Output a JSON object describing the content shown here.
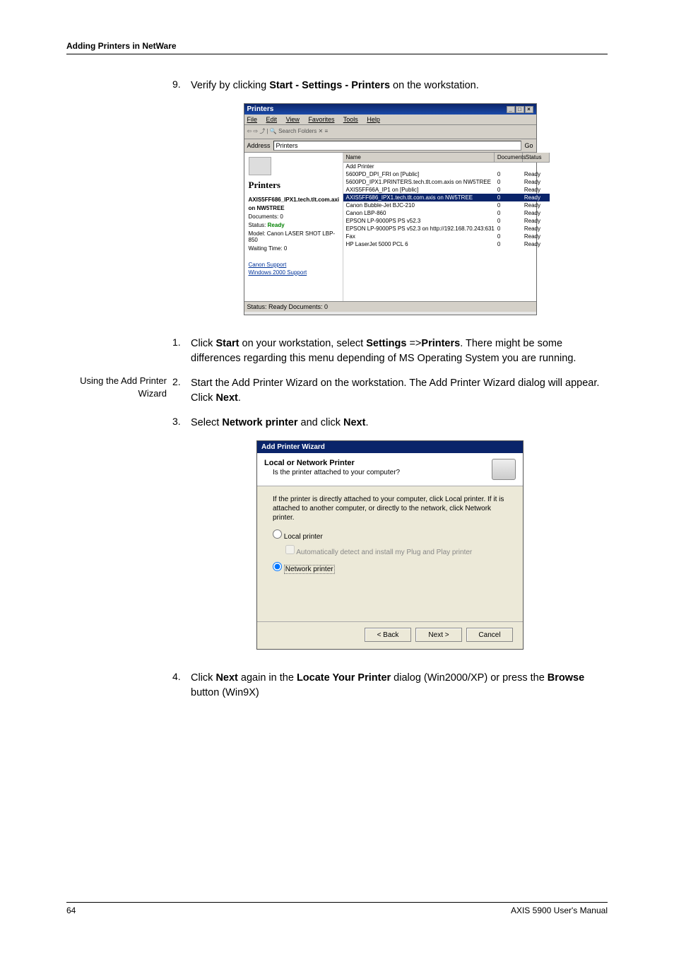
{
  "header": {
    "section_title": "Adding Printers in NetWare"
  },
  "step9": {
    "num": "9.",
    "text_before": "Verify by clicking ",
    "bold": "Start - Settings - Printers",
    "text_after": " on the workstation."
  },
  "printers_window": {
    "title": "Printers",
    "menu": {
      "file": "File",
      "edit": "Edit",
      "view": "View",
      "favorites": "Favorites",
      "tools": "Tools",
      "help": "Help"
    },
    "toolbar_hint": "Search    Folders",
    "address_label": "Address",
    "address_value": "Printers",
    "go_label": "Go",
    "left": {
      "title": "Printers",
      "selected_name_1": "AXIS5FF686_IPX1.tech.tlt.com.axi",
      "selected_name_2": "on NW5TREE",
      "documents_label": "Documents: 0",
      "status_label": "Status:",
      "status_value": "Ready",
      "model_label": "Model: Canon LASER SHOT LBP-850",
      "waiting_label": "Waiting Time: 0",
      "link_canon": "Canon Support",
      "link_windows": "Windows 2000 Support"
    },
    "columns": {
      "name": "Name",
      "documents": "Documents",
      "status": "Status"
    },
    "rows": [
      {
        "name": "Add Printer",
        "docs": "",
        "status": ""
      },
      {
        "name": "5600PD_DPI_FRI on [Public]",
        "docs": "0",
        "status": "Ready"
      },
      {
        "name": "5600PD_IPX1.PRINTERS.tech.tlt.com.axis on NW5TREE",
        "docs": "0",
        "status": "Ready"
      },
      {
        "name": "AXIS5FF66A_IP1 on [Public]",
        "docs": "0",
        "status": "Ready"
      },
      {
        "name": "AXIS5FF686_IPX1.tech.tlt.com.axis on NW5TREE",
        "docs": "0",
        "status": "Ready",
        "selected": true
      },
      {
        "name": "Canon Bubble-Jet BJC-210",
        "docs": "0",
        "status": "Ready"
      },
      {
        "name": "Canon LBP-860",
        "docs": "0",
        "status": "Ready"
      },
      {
        "name": "EPSON LP-9000PS PS v52.3",
        "docs": "0",
        "status": "Ready"
      },
      {
        "name": "EPSON LP-9000PS PS v52.3 on http://192.168.70.243:631",
        "docs": "0",
        "status": "Ready"
      },
      {
        "name": "Fax",
        "docs": "0",
        "status": "Ready"
      },
      {
        "name": "HP LaserJet 5000 PCL 6",
        "docs": "0",
        "status": "Ready"
      }
    ],
    "statusbar": "Status: Ready Documents: 0"
  },
  "sidebar": {
    "using_add_printer": "Using the Add Printer Wizard"
  },
  "step1": {
    "num": "1.",
    "t1": "Click ",
    "b1": "Start",
    "t2": " on your workstation, select ",
    "b2": "Settings",
    "t3": " =>",
    "b3": "Printers",
    "t4": ". There might be some differences regarding this menu depending of MS Operating System you are running."
  },
  "step2": {
    "num": "2.",
    "t1": "Start the Add Printer Wizard on the workstation. The Add Printer Wizard dialog will appear. Click ",
    "b1": "Next",
    "t2": "."
  },
  "step3": {
    "num": "3.",
    "t1": "Select ",
    "b1": "Network printer",
    "t2": " and click ",
    "b2": "Next",
    "t3": "."
  },
  "wizard": {
    "title": "Add Printer Wizard",
    "heading": "Local or Network Printer",
    "subheading": "Is the printer attached to your computer?",
    "instruction": "If the printer is directly attached to your computer, click Local printer. If it is attached to another computer, or directly to the network, click Network printer.",
    "opt_local": "Local printer",
    "opt_auto": "Automatically detect and install my Plug and Play printer",
    "opt_network": "Network printer",
    "btn_back": "< Back",
    "btn_next": "Next >",
    "btn_cancel": "Cancel"
  },
  "step4": {
    "num": "4.",
    "t1": "Click ",
    "b1": "Next",
    "t2": " again in the ",
    "b2": "Locate Your Printer",
    "t3": " dialog (Win2000/XP) or press the ",
    "b3": "Browse",
    "t4": " button (Win9X)"
  },
  "footer": {
    "page_number": "64",
    "manual_title": "AXIS 5900 User's Manual"
  }
}
